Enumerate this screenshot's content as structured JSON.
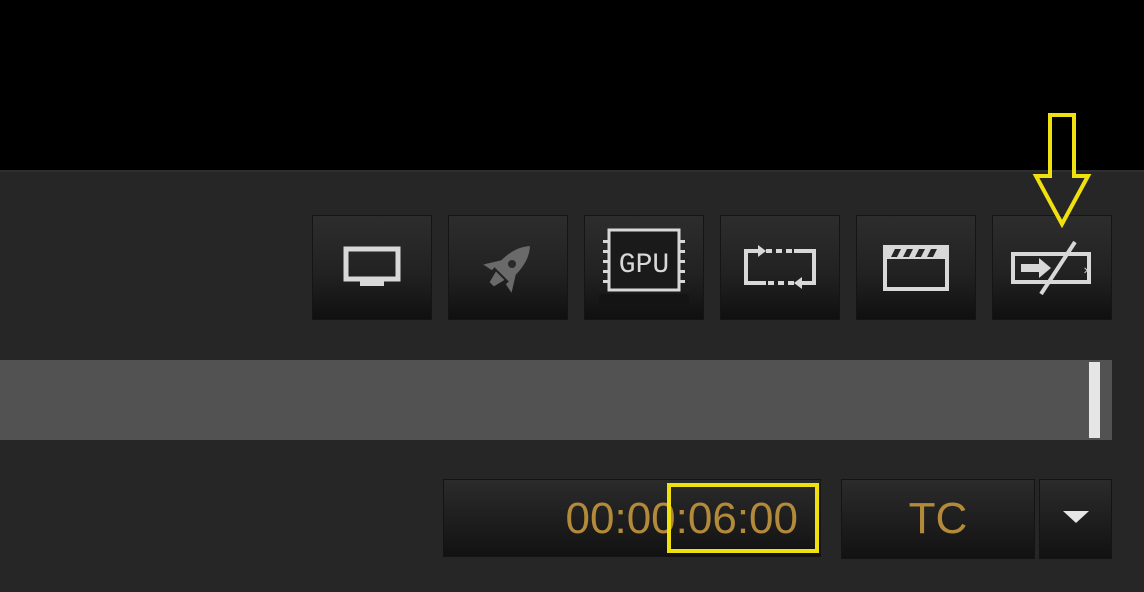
{
  "toolbar": {
    "buttons": [
      {
        "name": "display-button",
        "icon": "monitor-icon"
      },
      {
        "name": "accelerate-button",
        "icon": "rocket-icon"
      },
      {
        "name": "gpu-button",
        "icon": "gpu-chip-icon",
        "label": "GPU"
      },
      {
        "name": "loop-button",
        "icon": "loop-frame-icon"
      },
      {
        "name": "clapperboard-button",
        "icon": "clapperboard-icon"
      },
      {
        "name": "output-disabled-button",
        "icon": "output-disabled-icon"
      }
    ]
  },
  "playback": {
    "progress": 0.99
  },
  "timecode": {
    "value": "00:00:06:00",
    "mode_label": "TC",
    "dropdown_icon": "triangle-down-icon"
  },
  "colors": {
    "timecode_text": "#b38a3a",
    "highlight": "#f0e010",
    "panel_bg": "#262626",
    "track_bg": "#525252"
  }
}
